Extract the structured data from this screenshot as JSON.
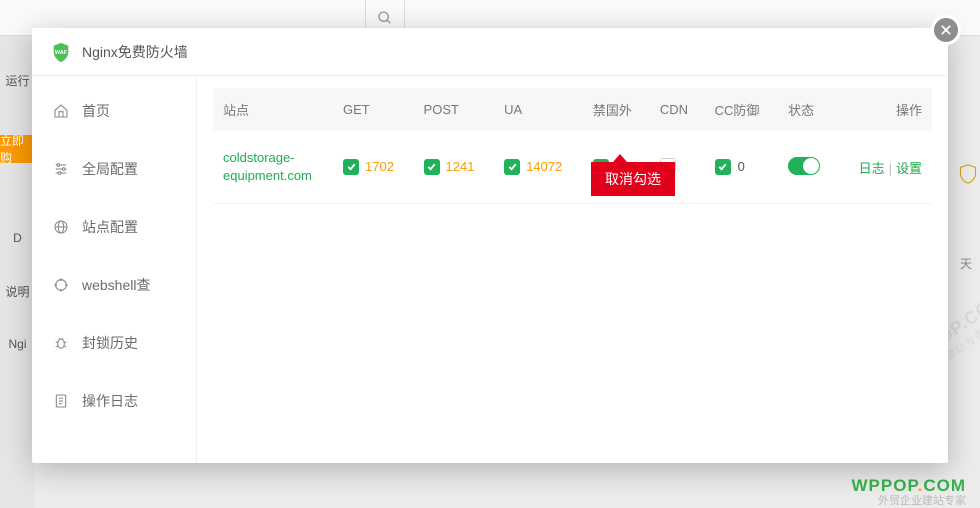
{
  "bg": {
    "left_labels": [
      "运行",
      "D",
      "说明",
      "Ngi"
    ],
    "buy": "立即购",
    "right_note": "天"
  },
  "watermark": {
    "logo": "WPPOP",
    "dot": ".",
    "com": "COM",
    "tag": "外贸企业建站专家"
  },
  "modal": {
    "title": "Nginx免费防火墙",
    "sidebar": [
      {
        "icon": "home-icon",
        "label": "首页"
      },
      {
        "icon": "sliders-icon",
        "label": "全局配置"
      },
      {
        "icon": "globe-icon",
        "label": "站点配置"
      },
      {
        "icon": "target-icon",
        "label": "webshell查"
      },
      {
        "icon": "bug-icon",
        "label": "封锁历史"
      },
      {
        "icon": "log-icon",
        "label": "操作日志"
      }
    ],
    "columns": {
      "site": "站点",
      "get": "GET",
      "post": "POST",
      "ua": "UA",
      "foreign": "禁国外",
      "cdn": "CDN",
      "cc": "CC防御",
      "status": "状态",
      "ops": "操作"
    },
    "row": {
      "site": "coldstorage-equipment.com",
      "get": "1702",
      "post": "1241",
      "ua": "14072",
      "cc": "0",
      "ops_log": "日志",
      "ops_set": "设置"
    },
    "callout": "取消勾选"
  }
}
